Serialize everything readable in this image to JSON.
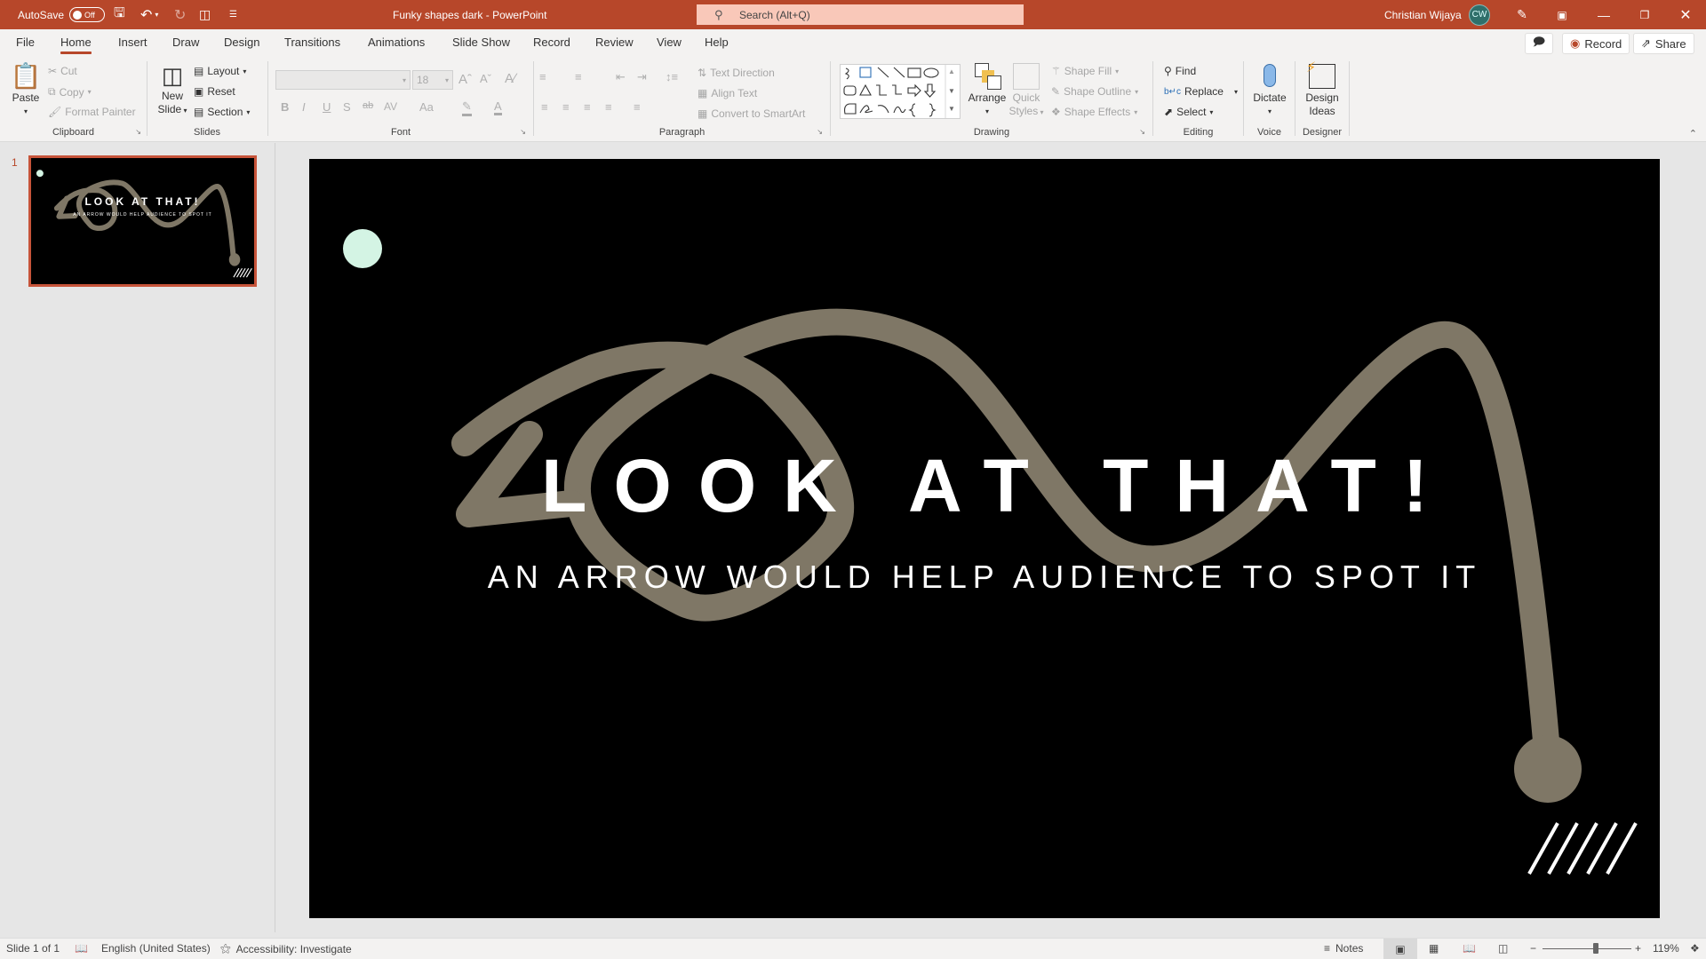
{
  "titlebar": {
    "autosave_label": "AutoSave",
    "autosave_state": "Off",
    "document_title": "Funky shapes dark",
    "separator": "-",
    "app_name": "PowerPoint",
    "search_placeholder": "Search (Alt+Q)",
    "user_name": "Christian Wijaya",
    "user_initials": "CW"
  },
  "menu": {
    "tabs": [
      "File",
      "Home",
      "Insert",
      "Draw",
      "Design",
      "Transitions",
      "Animations",
      "Slide Show",
      "Record",
      "Review",
      "View",
      "Help"
    ],
    "active_tab": "Home",
    "record_label": "Record",
    "share_label": "Share"
  },
  "ribbon": {
    "clipboard": {
      "label": "Clipboard",
      "paste": "Paste",
      "cut": "Cut",
      "copy": "Copy",
      "format_painter": "Format Painter"
    },
    "slides": {
      "label": "Slides",
      "new_slide_1": "New",
      "new_slide_2": "Slide",
      "layout": "Layout",
      "reset": "Reset",
      "section": "Section"
    },
    "font": {
      "label": "Font",
      "font_name": "",
      "font_size": "18",
      "bold": "B",
      "italic": "I",
      "underline": "U",
      "shadow": "S",
      "strike": "ab",
      "spacing": "AV",
      "case": "Aa"
    },
    "paragraph": {
      "label": "Paragraph",
      "text_direction": "Text Direction",
      "align_text": "Align Text",
      "convert_smartart": "Convert to SmartArt"
    },
    "drawing": {
      "label": "Drawing",
      "arrange": "Arrange",
      "quick_styles_1": "Quick",
      "quick_styles_2": "Styles",
      "shape_fill": "Shape Fill",
      "shape_outline": "Shape Outline",
      "shape_effects": "Shape Effects"
    },
    "editing": {
      "label": "Editing",
      "find": "Find",
      "replace": "Replace",
      "select": "Select"
    },
    "voice": {
      "label": "Voice",
      "dictate": "Dictate"
    },
    "designer": {
      "label": "Designer",
      "design_ideas_1": "Design",
      "design_ideas_2": "Ideas"
    }
  },
  "slides_panel": {
    "slides": [
      {
        "number": "1",
        "title": "LOOK AT THAT!",
        "subtitle": "AN ARROW WOULD HELP AUDIENCE TO SPOT IT"
      }
    ]
  },
  "slide": {
    "title": "LOOK AT THAT!",
    "subtitle": "AN ARROW WOULD HELP AUDIENCE TO SPOT IT",
    "colors": {
      "background": "#000000",
      "arrow": "#7f7766",
      "dot": "#d4f4e4",
      "text": "#ffffff",
      "accent": "#b7472a"
    }
  },
  "statusbar": {
    "slide_info": "Slide 1 of 1",
    "language": "English (United States)",
    "accessibility": "Accessibility: Investigate",
    "notes": "Notes",
    "zoom_level": "119%",
    "zoom_fraction": 0.6
  }
}
